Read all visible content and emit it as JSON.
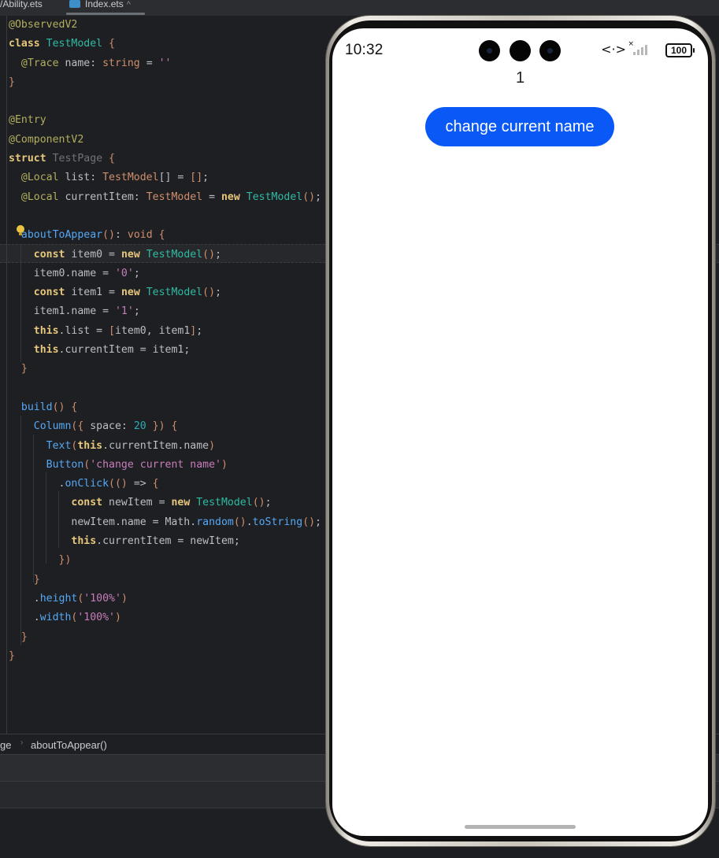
{
  "tabs": [
    {
      "label": "/Ability.ets"
    },
    {
      "label": "Index.ets",
      "close": "^"
    }
  ],
  "editor": {
    "lines": [
      [
        {
          "c": "t-ann",
          "t": "@ObservedV2"
        }
      ],
      [
        {
          "c": "t-kwb",
          "t": "class "
        },
        {
          "c": "t-cls",
          "t": "TestModel"
        },
        {
          "c": "t-br",
          "t": " {"
        }
      ],
      [
        {
          "c": "",
          "t": "  "
        },
        {
          "c": "t-ann",
          "t": "@Trace"
        },
        {
          "c": "",
          "t": " name: "
        },
        {
          "c": "t-type",
          "t": "string"
        },
        {
          "c": "",
          "t": " = "
        },
        {
          "c": "t-str",
          "t": "''"
        }
      ],
      [
        {
          "c": "t-br",
          "t": "}"
        }
      ],
      [
        {
          "c": "",
          "t": ""
        }
      ],
      [
        {
          "c": "t-ann",
          "t": "@Entry"
        }
      ],
      [
        {
          "c": "t-ann",
          "t": "@ComponentV2"
        }
      ],
      [
        {
          "c": "t-kwb",
          "t": "struct "
        },
        {
          "c": "t-clsg",
          "t": "TestPage"
        },
        {
          "c": "t-br",
          "t": " {"
        }
      ],
      [
        {
          "c": "",
          "t": "  "
        },
        {
          "c": "t-ann",
          "t": "@Local"
        },
        {
          "c": "",
          "t": " list: "
        },
        {
          "c": "t-type",
          "t": "TestModel"
        },
        {
          "c": "",
          "t": "[] = "
        },
        {
          "c": "t-br",
          "t": "[]"
        },
        {
          "c": "",
          "t": ";"
        }
      ],
      [
        {
          "c": "",
          "t": "  "
        },
        {
          "c": "t-ann",
          "t": "@Local"
        },
        {
          "c": "",
          "t": " currentItem: "
        },
        {
          "c": "t-type",
          "t": "TestModel"
        },
        {
          "c": "",
          "t": " = "
        },
        {
          "c": "t-kwb",
          "t": "new "
        },
        {
          "c": "t-cls",
          "t": "TestModel"
        },
        {
          "c": "t-br",
          "t": "()"
        },
        {
          "c": "",
          "t": ";"
        }
      ],
      [
        {
          "c": "",
          "t": ""
        }
      ],
      [
        {
          "c": "",
          "t": "  "
        },
        {
          "c": "t-fn",
          "t": "aboutToAppear"
        },
        {
          "c": "t-br",
          "t": "()"
        },
        {
          "c": "",
          "t": ": "
        },
        {
          "c": "t-type",
          "t": "void"
        },
        {
          "c": "t-br",
          "t": " {"
        }
      ],
      [
        {
          "c": "",
          "t": "    "
        },
        {
          "c": "t-kwb",
          "t": "const"
        },
        {
          "c": "",
          "t": " item0 = "
        },
        {
          "c": "t-kwb",
          "t": "new "
        },
        {
          "c": "t-cls",
          "t": "TestModel"
        },
        {
          "c": "t-br",
          "t": "()"
        },
        {
          "c": "",
          "t": ";"
        }
      ],
      [
        {
          "c": "",
          "t": "    item0.name = "
        },
        {
          "c": "t-str",
          "t": "'0'"
        },
        {
          "c": "",
          "t": ";"
        }
      ],
      [
        {
          "c": "",
          "t": "    "
        },
        {
          "c": "t-kwb",
          "t": "const"
        },
        {
          "c": "",
          "t": " item1 = "
        },
        {
          "c": "t-kwb",
          "t": "new "
        },
        {
          "c": "t-cls",
          "t": "TestModel"
        },
        {
          "c": "t-br",
          "t": "()"
        },
        {
          "c": "",
          "t": ";"
        }
      ],
      [
        {
          "c": "",
          "t": "    item1.name = "
        },
        {
          "c": "t-str",
          "t": "'1'"
        },
        {
          "c": "",
          "t": ";"
        }
      ],
      [
        {
          "c": "",
          "t": "    "
        },
        {
          "c": "t-kwb",
          "t": "this"
        },
        {
          "c": "",
          "t": ".list = "
        },
        {
          "c": "t-br",
          "t": "["
        },
        {
          "c": "",
          "t": "item0, item1"
        },
        {
          "c": "t-br",
          "t": "]"
        },
        {
          "c": "",
          "t": ";"
        }
      ],
      [
        {
          "c": "",
          "t": "    "
        },
        {
          "c": "t-kwb",
          "t": "this"
        },
        {
          "c": "",
          "t": ".currentItem = item1;"
        }
      ],
      [
        {
          "c": "",
          "t": "  "
        },
        {
          "c": "t-br",
          "t": "}"
        }
      ],
      [
        {
          "c": "",
          "t": ""
        }
      ],
      [
        {
          "c": "",
          "t": "  "
        },
        {
          "c": "t-fn",
          "t": "build"
        },
        {
          "c": "t-br",
          "t": "()"
        },
        {
          "c": "t-br",
          "t": " {"
        }
      ],
      [
        {
          "c": "",
          "t": "    "
        },
        {
          "c": "t-fn",
          "t": "Column"
        },
        {
          "c": "t-br",
          "t": "({"
        },
        {
          "c": "",
          "t": " space: "
        },
        {
          "c": "t-num",
          "t": "20"
        },
        {
          "c": "t-br",
          "t": " })"
        },
        {
          "c": "t-br",
          "t": " {"
        }
      ],
      [
        {
          "c": "",
          "t": "      "
        },
        {
          "c": "t-fn",
          "t": "Text"
        },
        {
          "c": "t-br",
          "t": "("
        },
        {
          "c": "t-kwb",
          "t": "this"
        },
        {
          "c": "",
          "t": ".currentItem.name"
        },
        {
          "c": "t-br",
          "t": ")"
        }
      ],
      [
        {
          "c": "",
          "t": "      "
        },
        {
          "c": "t-fn",
          "t": "Button"
        },
        {
          "c": "t-br",
          "t": "("
        },
        {
          "c": "t-str",
          "t": "'change current name'"
        },
        {
          "c": "t-br",
          "t": ")"
        }
      ],
      [
        {
          "c": "",
          "t": "        ."
        },
        {
          "c": "t-fn",
          "t": "onClick"
        },
        {
          "c": "t-br",
          "t": "(()"
        },
        {
          "c": "",
          "t": " => "
        },
        {
          "c": "t-br",
          "t": "{"
        }
      ],
      [
        {
          "c": "",
          "t": "          "
        },
        {
          "c": "t-kwb",
          "t": "const"
        },
        {
          "c": "",
          "t": " newItem = "
        },
        {
          "c": "t-kwb",
          "t": "new "
        },
        {
          "c": "t-cls",
          "t": "TestModel"
        },
        {
          "c": "t-br",
          "t": "()"
        },
        {
          "c": "",
          "t": ";"
        }
      ],
      [
        {
          "c": "",
          "t": "          newItem.name = Math."
        },
        {
          "c": "t-fn",
          "t": "random"
        },
        {
          "c": "t-br",
          "t": "()"
        },
        {
          "c": "",
          "t": "."
        },
        {
          "c": "t-fn",
          "t": "toString"
        },
        {
          "c": "t-br",
          "t": "()"
        },
        {
          "c": "",
          "t": ";"
        }
      ],
      [
        {
          "c": "",
          "t": "          "
        },
        {
          "c": "t-kwb",
          "t": "this"
        },
        {
          "c": "",
          "t": ".currentItem = newItem;"
        }
      ],
      [
        {
          "c": "",
          "t": "        "
        },
        {
          "c": "t-br",
          "t": "})"
        }
      ],
      [
        {
          "c": "",
          "t": "    "
        },
        {
          "c": "t-br",
          "t": "}"
        }
      ],
      [
        {
          "c": "",
          "t": "    ."
        },
        {
          "c": "t-fn",
          "t": "height"
        },
        {
          "c": "t-br",
          "t": "("
        },
        {
          "c": "t-str",
          "t": "'100%'"
        },
        {
          "c": "t-br",
          "t": ")"
        }
      ],
      [
        {
          "c": "",
          "t": "    ."
        },
        {
          "c": "t-fn",
          "t": "width"
        },
        {
          "c": "t-br",
          "t": "("
        },
        {
          "c": "t-str",
          "t": "'100%'"
        },
        {
          "c": "t-br",
          "t": ")"
        }
      ],
      [
        {
          "c": "",
          "t": "  "
        },
        {
          "c": "t-br",
          "t": "}"
        }
      ],
      [
        {
          "c": "t-br",
          "t": "}"
        }
      ]
    ]
  },
  "breadcrumb": {
    "parent": "ge",
    "current": "aboutToAppear()"
  },
  "preview": {
    "status": {
      "time": "10:32",
      "battery": "100"
    },
    "text_value": "1",
    "button_label": "change current name",
    "button_color": "#0a59f7"
  }
}
